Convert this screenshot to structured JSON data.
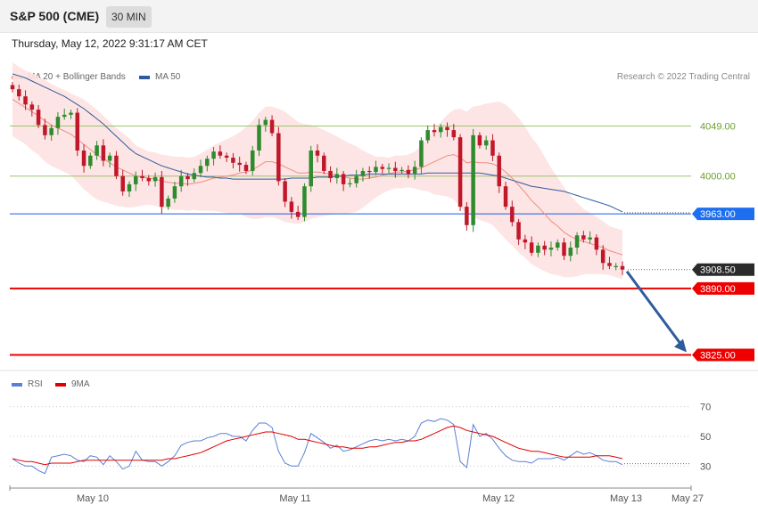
{
  "header": {
    "title": "S&P 500 (CME)",
    "interval": "30 MIN"
  },
  "timestamp": "Thursday, May 12, 2022 9:31:17 AM CET",
  "legend_main": [
    {
      "label": "MA 20 + Bollinger Bands",
      "color": "#f28b82"
    },
    {
      "label": "MA 50",
      "color": "#2f5b9e"
    }
  ],
  "credit": "Research © 2022 Trading Central",
  "legend_rsi": [
    {
      "label": "RSI",
      "color": "#5b7fd6"
    },
    {
      "label": "9MA",
      "color": "#e00000"
    }
  ],
  "colors": {
    "up": "#2e8b2e",
    "down": "#c0182a",
    "support": "#ee0000",
    "ma50": "#2f5b9e",
    "ma20": "#f28b82",
    "band": "#fde2e2",
    "arrow": "#2f5b9e"
  },
  "chart_data": [
    {
      "type": "candlestick",
      "ylim": [
        3815,
        4120
      ],
      "x_ticks": [
        "May 10",
        "May 11",
        "May 12",
        "May 13",
        "May 27"
      ],
      "levels": [
        {
          "value": 4049.0,
          "label": "4049.00",
          "kind": "resistance",
          "color": "#9bc46b"
        },
        {
          "value": 4000.0,
          "label": "4000.00",
          "kind": "resistance",
          "color": "#9bc46b"
        },
        {
          "value": 3963.0,
          "label": "3963.00",
          "kind": "ma50",
          "color": "#1e5ae6"
        },
        {
          "value": 3908.5,
          "label": "3908.50",
          "kind": "last-price",
          "color": "#2b2b2b"
        },
        {
          "value": 3890.0,
          "label": "3890.00",
          "kind": "support",
          "color": "#ee0000"
        },
        {
          "value": 3825.0,
          "label": "3825.00",
          "kind": "support",
          "color": "#ee0000"
        }
      ],
      "forecast_arrow": {
        "from": 3908.5,
        "to": 3825
      },
      "close": [
        4085,
        4078,
        4070,
        4065,
        4050,
        4040,
        4047,
        4058,
        4060,
        4062,
        4025,
        4010,
        4020,
        4030,
        4015,
        4020,
        4000,
        3985,
        3992,
        4000,
        3998,
        3995,
        3999,
        3970,
        3978,
        3990,
        4000,
        3997,
        4003,
        4010,
        4017,
        4024,
        4020,
        4018,
        4013,
        4011,
        4005,
        4025,
        4050,
        4055,
        4042,
        3995,
        3975,
        3965,
        3960,
        3990,
        4025,
        4020,
        4005,
        3998,
        4002,
        3992,
        3993,
        4000,
        4005,
        4004,
        4009,
        4007,
        4008,
        4005,
        4006,
        4002,
        4009,
        4035,
        4045,
        4043,
        4048,
        4045,
        4038,
        3970,
        3952,
        4040,
        4030,
        4035,
        4020,
        3990,
        3970,
        3955,
        3938,
        3935,
        3925,
        3932,
        3928,
        3930,
        3935,
        3922,
        3930,
        3942,
        3938,
        3940,
        3928,
        3915,
        3912,
        3912,
        3908.5
      ],
      "ma20": [
        4075,
        4071,
        4067,
        4063,
        4059,
        4054,
        4050,
        4047,
        4044,
        4041,
        4036,
        4031,
        4026,
        4021,
        4017,
        4013,
        4009,
        4006,
        4003,
        4000,
        3999,
        3998,
        3997,
        3995,
        3994,
        3993,
        3993,
        3992,
        3993,
        3994,
        3996,
        3998,
        3999,
        4000,
        4001,
        4003,
        4004,
        4006,
        4010,
        4014,
        4014,
        4012,
        4009,
        4006,
        4003,
        4003,
        4004,
        4004,
        4003,
        4002,
        4001,
        3999,
        3998,
        3997,
        3997,
        3998,
        3999,
        4001,
        4002,
        4004,
        4004,
        4005,
        4006,
        4008,
        4011,
        4014,
        4017,
        4020,
        4021,
        4018,
        4013,
        4014,
        4013,
        4013,
        4012,
        4009,
        4004,
        3998,
        3991,
        3984,
        3976,
        3970,
        3963,
        3956,
        3951,
        3945,
        3941,
        3938,
        3936,
        3934,
        3932,
        3930,
        3927,
        3925,
        3923
      ],
      "ma20_sd": [
        18,
        18,
        18,
        19,
        19,
        20,
        20,
        20,
        20,
        20,
        21,
        22,
        22,
        22,
        21,
        20,
        19,
        18,
        17,
        15,
        14,
        13,
        13,
        13,
        13,
        13,
        13,
        13,
        13,
        14,
        15,
        16,
        17,
        18,
        19,
        20,
        22,
        24,
        26,
        27,
        27,
        27,
        27,
        26,
        25,
        24,
        23,
        22,
        21,
        20,
        19,
        18,
        17,
        16,
        14,
        12,
        10,
        9,
        8,
        8,
        8,
        8,
        9,
        11,
        13,
        16,
        18,
        20,
        22,
        24,
        25,
        27,
        28,
        29,
        30,
        32,
        33,
        33,
        33,
        32,
        31,
        30,
        28,
        26,
        24,
        22,
        20,
        18,
        16,
        15,
        14,
        13,
        12,
        12,
        12
      ],
      "ma50": [
        4100,
        4098,
        4096,
        4093,
        4090,
        4087,
        4084,
        4081,
        4078,
        4074,
        4070,
        4066,
        4061,
        4056,
        4051,
        4045,
        4039,
        4033,
        4027,
        4022,
        4019,
        4016,
        4013,
        4010,
        4008,
        4006,
        4004,
        4002,
        4001,
        4000,
        3999,
        3999,
        3998,
        3998,
        3997,
        3997,
        3997,
        3997,
        3997,
        3997,
        3997,
        3997,
        3997,
        3998,
        3998,
        3998,
        3998,
        3999,
        3999,
        3999,
        4000,
        4000,
        4001,
        4001,
        4001,
        4002,
        4002,
        4002,
        4002,
        4002,
        4002,
        4002,
        4002,
        4002,
        4003,
        4003,
        4003,
        4003,
        4003,
        4003,
        4003,
        4003,
        4003,
        4002,
        4001,
        4000,
        3998,
        3996,
        3994,
        3992,
        3990,
        3989,
        3988,
        3987,
        3986,
        3985,
        3983,
        3981,
        3979,
        3977,
        3975,
        3973,
        3971,
        3968,
        3965
      ]
    },
    {
      "type": "line",
      "ylim": [
        20,
        80
      ],
      "y_ticks": [
        30,
        50,
        70
      ],
      "series": [
        {
          "name": "RSI",
          "values": [
            35,
            32,
            30,
            30,
            27,
            25,
            36,
            37,
            38,
            37,
            34,
            33,
            37,
            36,
            31,
            37,
            33,
            28,
            30,
            40,
            34,
            33,
            33,
            30,
            33,
            37,
            44,
            46,
            47,
            47,
            49,
            50,
            52,
            52,
            50,
            50,
            47,
            54,
            59,
            59,
            56,
            40,
            32,
            30,
            30,
            39,
            52,
            49,
            46,
            42,
            44,
            40,
            41,
            43,
            45,
            47,
            48,
            47,
            48,
            47,
            48,
            47,
            50,
            59,
            61,
            60,
            62,
            61,
            58,
            33,
            29,
            58,
            50,
            52,
            48,
            42,
            37,
            34,
            33,
            33,
            32,
            35,
            35,
            35,
            36,
            34,
            37,
            40,
            38,
            39,
            37,
            34,
            33,
            33,
            31
          ]
        },
        {
          "name": "9MA",
          "values": [
            35,
            34,
            33,
            33,
            32,
            31,
            32,
            32,
            32,
            32,
            33,
            34,
            34,
            34,
            34,
            34,
            34,
            34,
            34,
            34,
            34,
            34,
            34,
            34,
            35,
            35,
            36,
            37,
            38,
            39,
            41,
            43,
            45,
            47,
            48,
            49,
            50,
            51,
            52,
            53,
            53,
            52,
            51,
            50,
            48,
            48,
            47,
            46,
            45,
            44,
            43,
            43,
            42,
            42,
            42,
            43,
            43,
            44,
            45,
            46,
            46,
            47,
            47,
            48,
            50,
            52,
            54,
            56,
            57,
            56,
            54,
            53,
            52,
            51,
            50,
            48,
            46,
            44,
            42,
            41,
            40,
            40,
            39,
            38,
            37,
            36,
            36,
            36,
            36,
            36,
            37,
            37,
            37,
            36,
            35
          ]
        }
      ]
    }
  ]
}
